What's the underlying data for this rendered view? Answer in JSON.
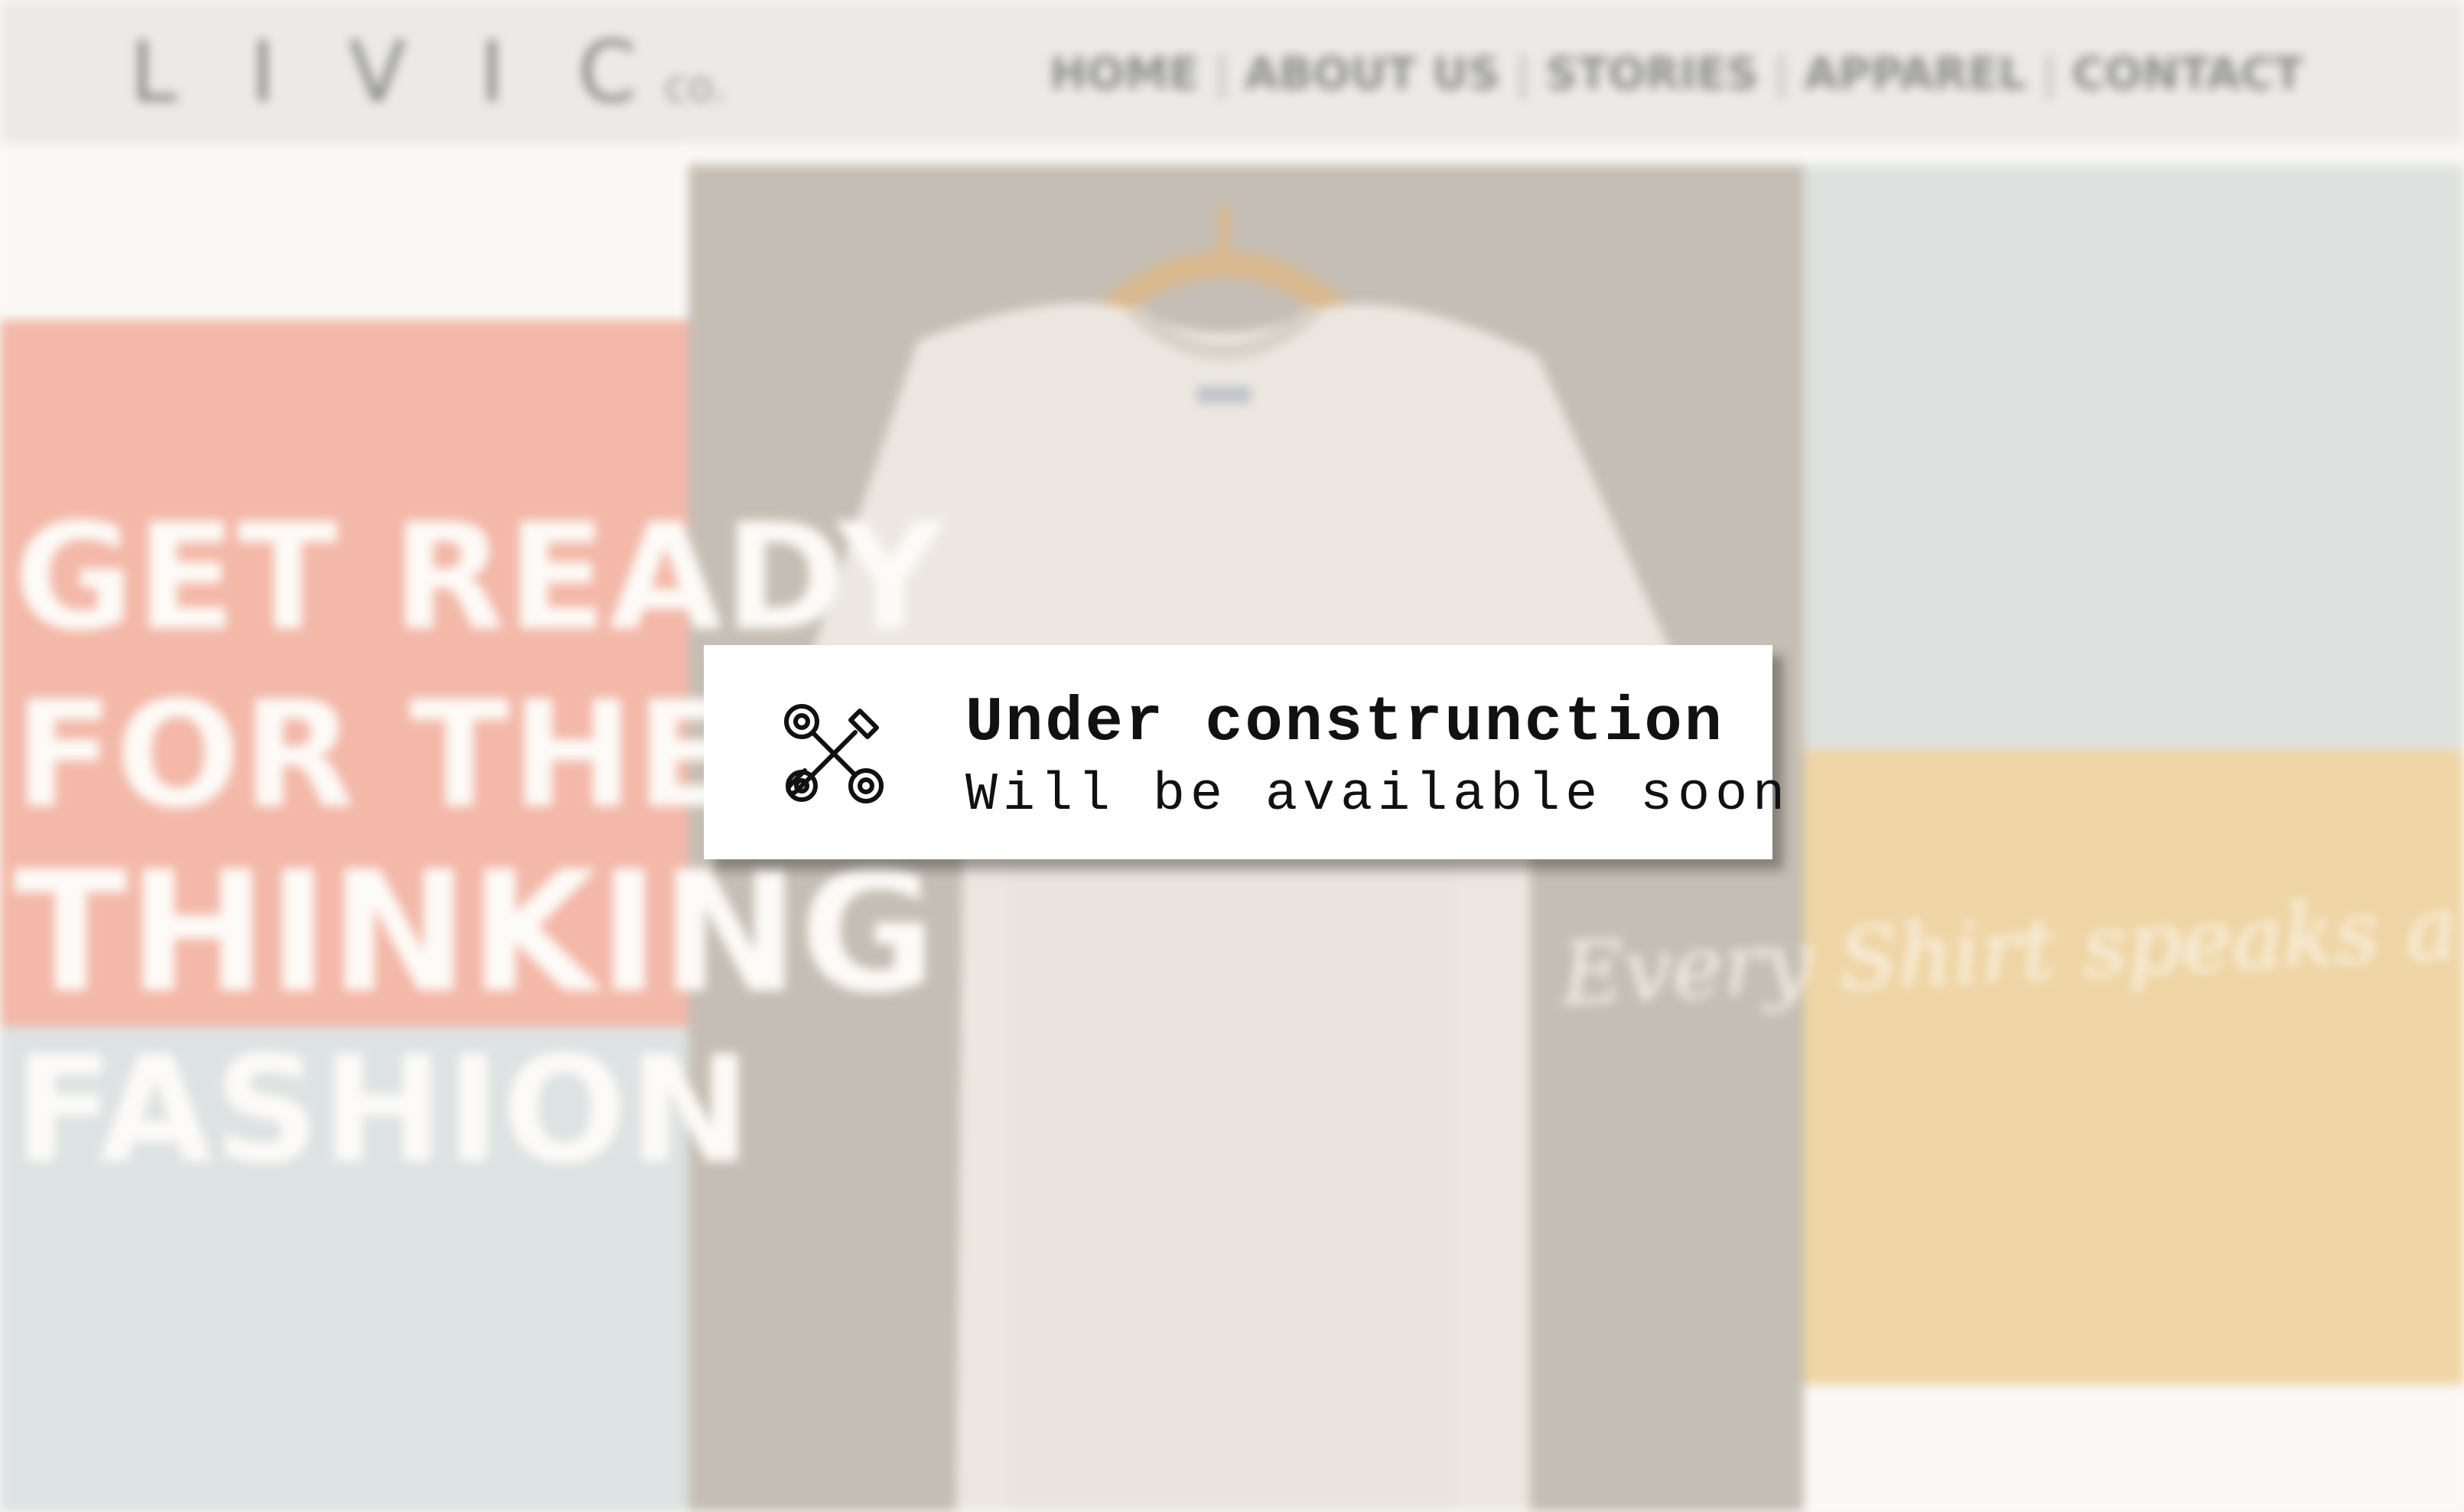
{
  "site": {
    "logo": {
      "main": "LIVIC",
      "sub": "co."
    },
    "nav": {
      "items": [
        "HOME",
        "ABOUT US",
        "STORIES",
        "APPAREL",
        "CONTACT"
      ],
      "separator": "|"
    },
    "hero": {
      "headline_lines": [
        "GET READY",
        "FOR THE",
        "THINKING",
        "FASHION"
      ],
      "tagline": "Every Shirt speaks a Story"
    },
    "colors": {
      "salmon": "#f3b8a8",
      "grey": "#dde3e2",
      "sand": "#c5beb4",
      "yellow": "#efd5a5",
      "topbar": "#ebeae8"
    }
  },
  "notice": {
    "icon": "tools-icon",
    "title": "Under construnction",
    "subtitle": "Will be available soon"
  }
}
